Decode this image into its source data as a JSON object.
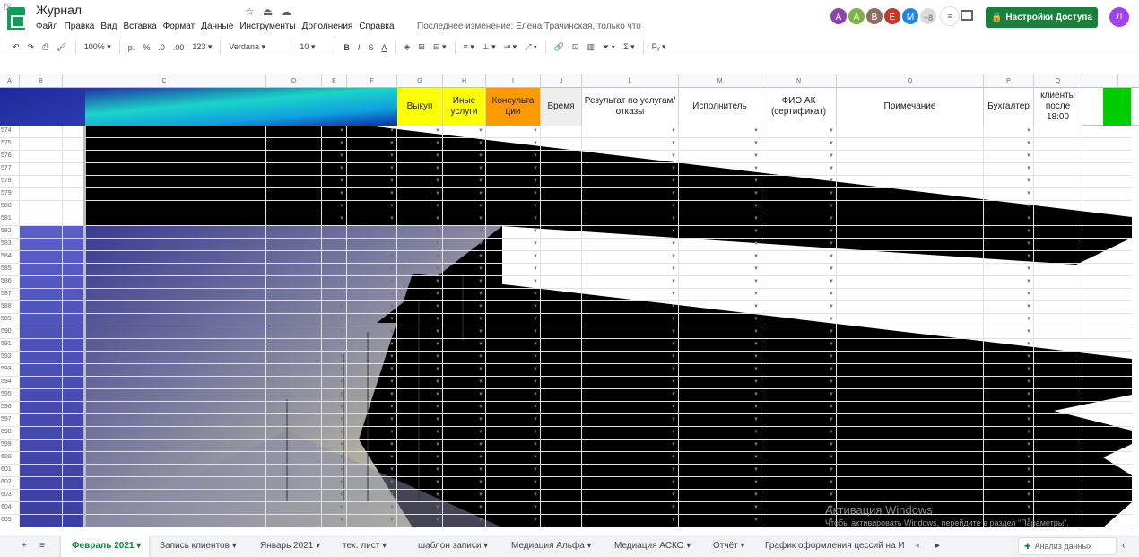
{
  "app": {
    "title": "Журнал",
    "menu": [
      "Файл",
      "Правка",
      "Вид",
      "Вставка",
      "Формат",
      "Данные",
      "Инструменты",
      "Дополнения",
      "Справка"
    ],
    "last_edit": "Последнее изменение: Елена Трачинская, только что"
  },
  "collaborators": {
    "avatars": [
      {
        "letter": "А",
        "color": "#8e44ad"
      },
      {
        "letter": "А",
        "color": "#7cb342"
      },
      {
        "letter": "В",
        "color": "#8d6e63"
      },
      {
        "letter": "Е",
        "color": "#c0392b"
      },
      {
        "letter": "М",
        "color": "#1e88e5"
      }
    ],
    "more": "+8"
  },
  "share_button": "Настройки Доступа",
  "user_avatar": "Л",
  "toolbar": {
    "zoom": "100%",
    "currency": "р.",
    "percent": "%",
    "dec1": ".0",
    "dec2": ".00",
    "format": "123",
    "font": "Verdana",
    "font_size": "10"
  },
  "formula_bar": {
    "fx": "fx"
  },
  "columns": [
    {
      "letter": "A",
      "w": 22
    },
    {
      "letter": "B",
      "w": 48
    },
    {
      "letter": "C",
      "w": 227
    },
    {
      "letter": "D",
      "w": 62
    },
    {
      "letter": "E",
      "w": 28
    },
    {
      "letter": "F",
      "w": 56
    },
    {
      "letter": "G",
      "w": 51
    },
    {
      "letter": "H",
      "w": 48
    },
    {
      "letter": "I",
      "w": 61
    },
    {
      "letter": "J",
      "w": 46
    },
    {
      "letter": "L",
      "w": 108
    },
    {
      "letter": "M",
      "w": 92
    },
    {
      "letter": "N",
      "w": 84
    },
    {
      "letter": "O",
      "w": 164
    },
    {
      "letter": "P",
      "w": 56
    },
    {
      "letter": "Q",
      "w": 54
    },
    {
      "letter": "",
      "w": 40
    }
  ],
  "header_cells": {
    "G": "Выкуп",
    "H": "Иные услуги",
    "I": "Консульта ции",
    "J": "Время",
    "L": "Результат по услугам/отказы",
    "M": "Исполнитель",
    "N": "ФИО АК (сертификат)",
    "O": "Примечание",
    "P": "Бухгалтер",
    "Q": "клиенты после 18:00"
  },
  "header_colors": {
    "G": "#ffff00",
    "H": "#ffff00",
    "I": "#ff9900",
    "J": "#eeeeee",
    "R": "#00cc00"
  },
  "rows": [
    "574",
    "575",
    "576",
    "577",
    "578",
    "579",
    "580",
    "581",
    "582",
    "583",
    "584",
    "585",
    "586",
    "587",
    "588",
    "589",
    "590",
    "591",
    "592",
    "593",
    "594",
    "595",
    "596",
    "597",
    "598",
    "599",
    "600",
    "601",
    "602",
    "603",
    "604",
    "605"
  ],
  "sheets": [
    "Февраль 2021",
    "Запись клиентов",
    "Январь 2021",
    "тех. лист",
    "шаблон записи",
    "Медиация Альфа",
    "Медиация АСКО",
    "Отчёт",
    "График оформления цессий на И"
  ],
  "explore": "Анализ данных",
  "watermark": {
    "title": "Активация Windows",
    "text": "Чтобы активировать Windows, перейдите в раздел \"Параметры\"."
  }
}
